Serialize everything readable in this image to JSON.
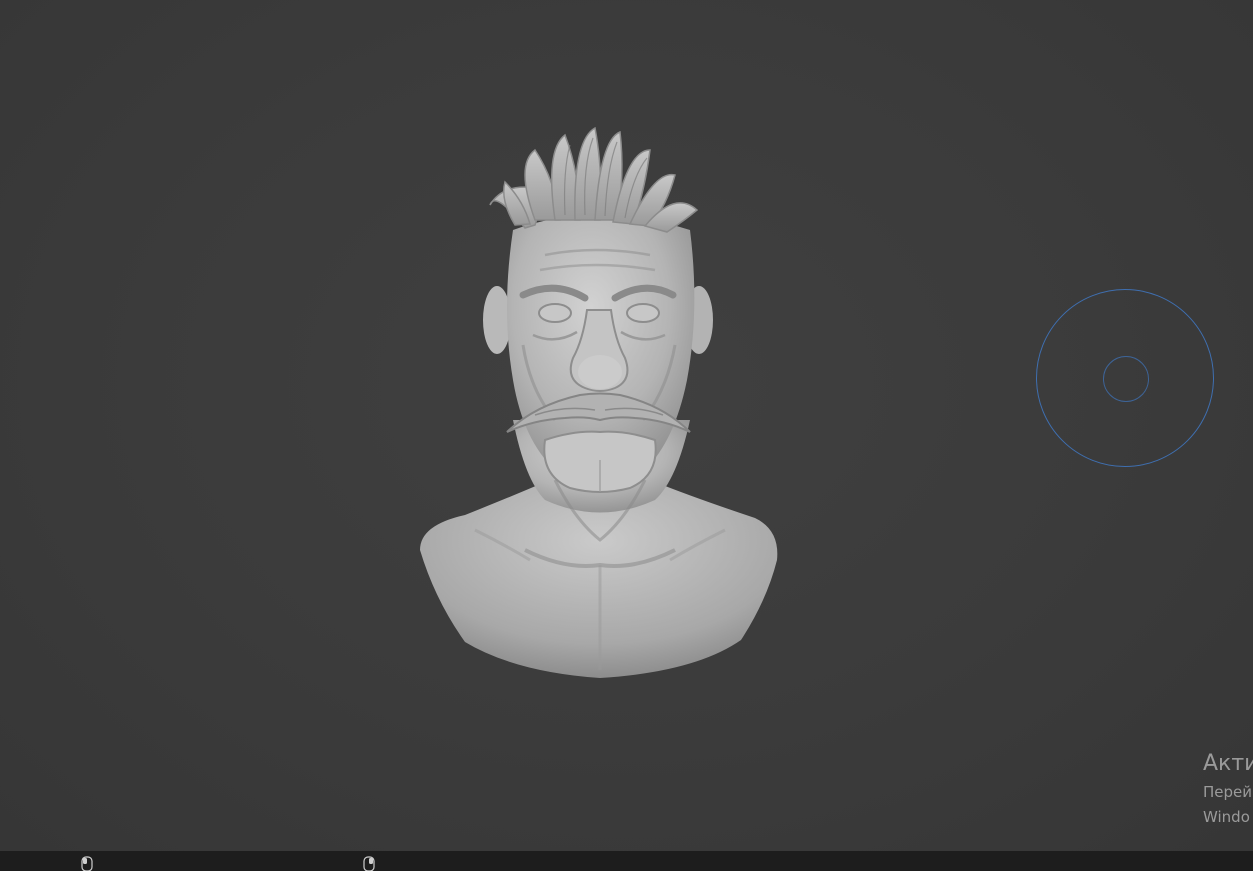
{
  "viewport": {
    "background": "#3a3a3a",
    "object": "sculpted male bust with slicked hair, bushy mustache and furrowed brow",
    "brush_cursor_color": "#3f6fb0"
  },
  "watermark": {
    "title": "Акти",
    "line1": "Перей",
    "line2": "Windo"
  },
  "statusbar": {
    "icons": [
      "mouse-left-icon",
      "mouse-right-icon"
    ]
  }
}
